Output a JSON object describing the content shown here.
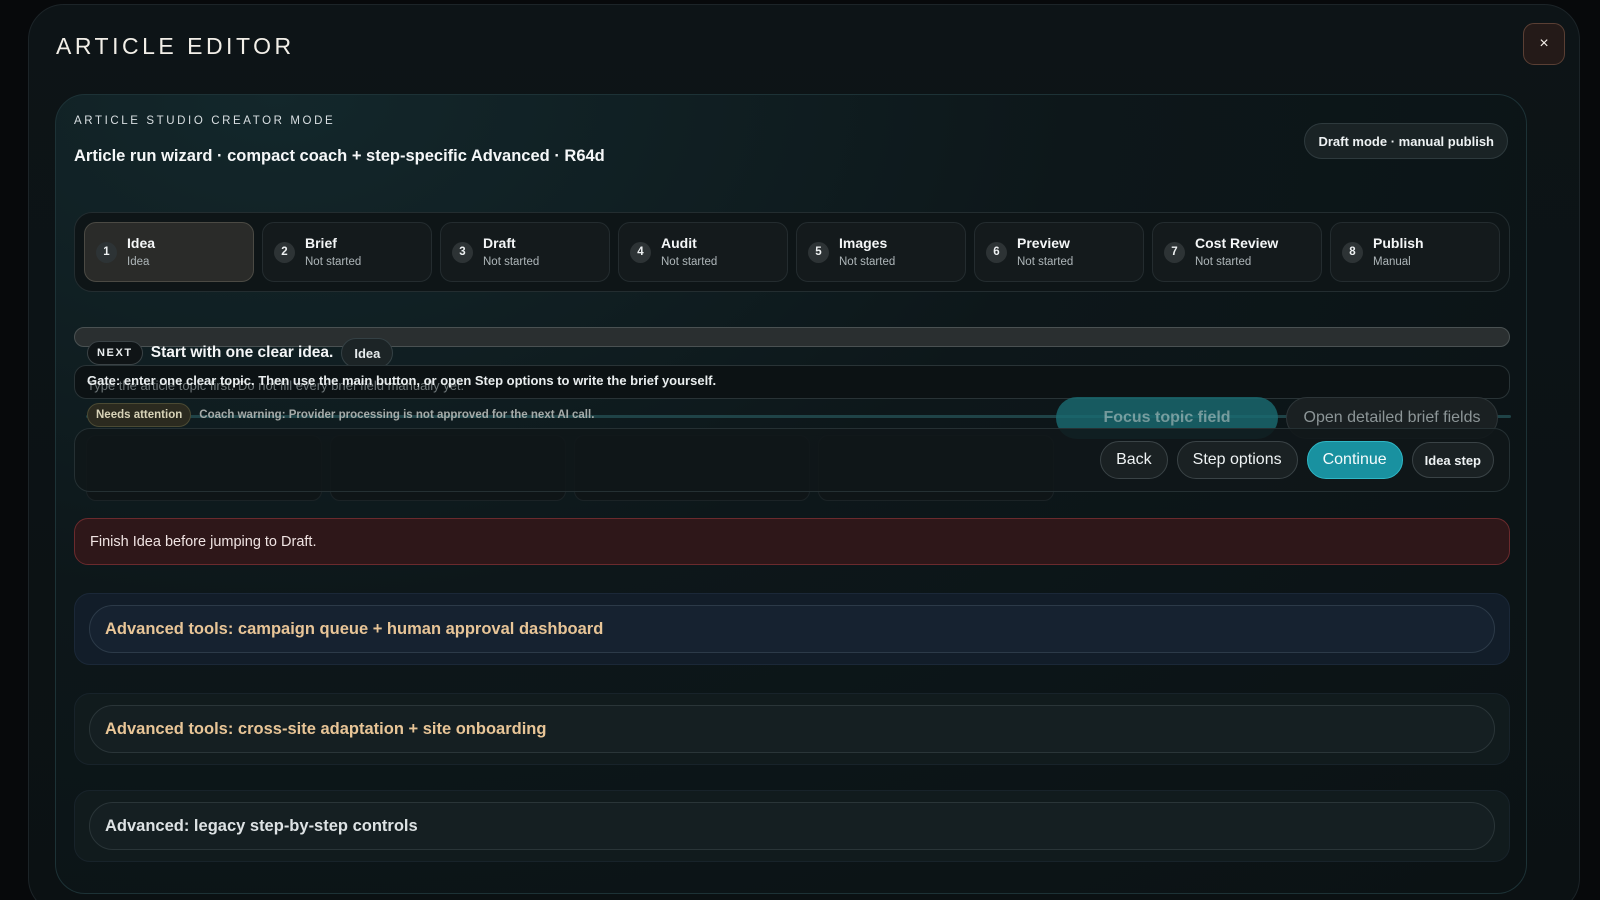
{
  "window": {
    "title": "ARTICLE EDITOR",
    "close_label": "×"
  },
  "studio": {
    "eyebrow": "ARTICLE STUDIO CREATOR MODE",
    "subtitle": "Article run wizard · compact coach + step-specific Advanced · R64d",
    "mode_pill": "Draft mode · manual publish"
  },
  "steps": [
    {
      "num": "1",
      "name": "Idea",
      "status": "Idea",
      "active": true
    },
    {
      "num": "2",
      "name": "Brief",
      "status": "Not started"
    },
    {
      "num": "3",
      "name": "Draft",
      "status": "Not started"
    },
    {
      "num": "4",
      "name": "Audit",
      "status": "Not started"
    },
    {
      "num": "5",
      "name": "Images",
      "status": "Not started"
    },
    {
      "num": "6",
      "name": "Preview",
      "status": "Not started"
    },
    {
      "num": "7",
      "name": "Cost Review",
      "status": "Not started"
    },
    {
      "num": "8",
      "name": "Publish",
      "status": "Manual"
    }
  ],
  "coach": {
    "next_tag": "NEXT",
    "next_text": "Start with one clear idea.",
    "step_chip": "Idea",
    "gate_placeholder": "Type the article topic first. Do not fill every brief field manually yet.",
    "gate_text": "Gate: enter one clear topic. Then use the main button, or open Step options to write the brief yourself.",
    "needs_badge": "Needs attention",
    "warning_text": "Coach warning: Provider processing is not approved for the next AI call.",
    "ghost_focus": "Focus topic field",
    "ghost_open": "Open detailed brief fields"
  },
  "actions": {
    "back": "Back",
    "step_options": "Step options",
    "continue": "Continue",
    "step_label": "Idea step"
  },
  "error": {
    "message": "Finish Idea before jumping to Draft."
  },
  "advanced": [
    {
      "label": "Advanced tools: campaign queue + human approval dashboard"
    },
    {
      "label": "Advanced tools: cross-site adaptation + site onboarding"
    },
    {
      "label": "Advanced: legacy step-by-step controls"
    }
  ],
  "colors": {
    "accent": "#1991a0",
    "warning_text": "#e8c597",
    "error_bg": "#2e1719"
  }
}
